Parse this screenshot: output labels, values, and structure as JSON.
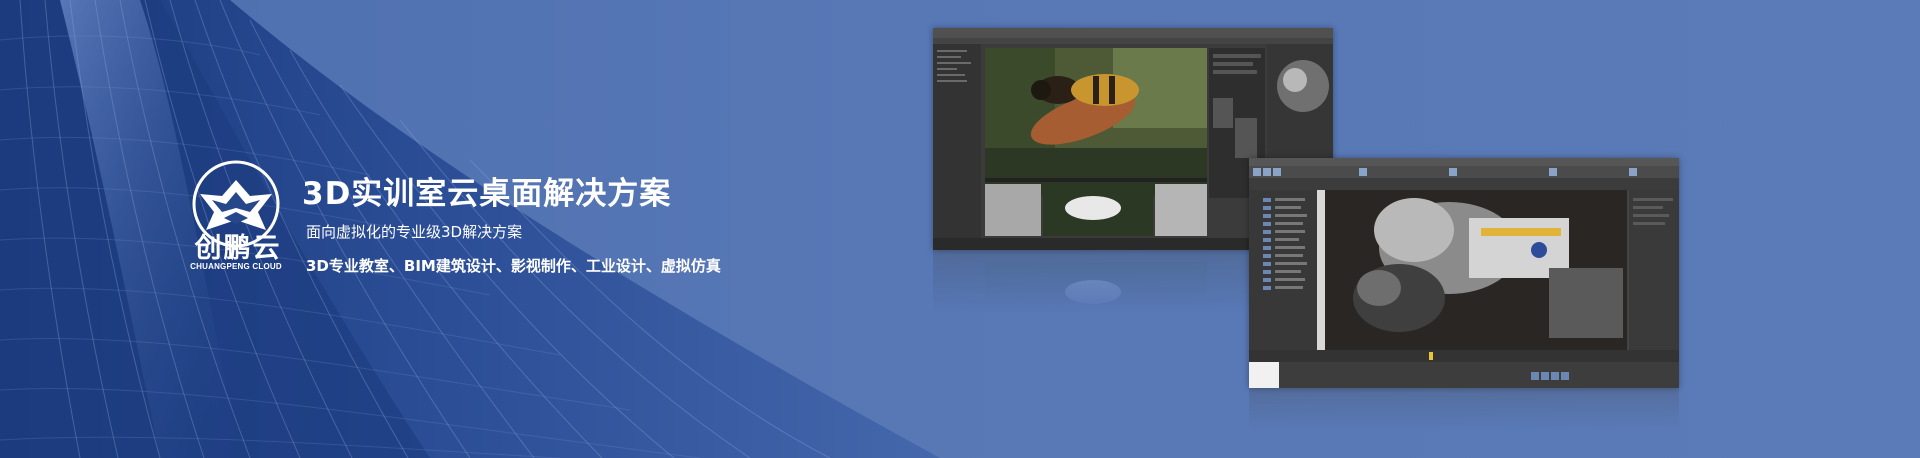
{
  "banner": {
    "title": "3D实训室云桌面解决方案",
    "subtitle": "面向虚拟化的专业级3D解决方案",
    "fields": "3D专业教室、BIM建筑设计、影视制作、工业设计、虚拟仿真"
  },
  "logo": {
    "brand": "创鹏云",
    "sub": "CHUANGPENG CLOUD",
    "icon": "star-in-circle-logo"
  },
  "screenshots": [
    {
      "name": "maya-bee-render",
      "icon": "3d-software-window"
    },
    {
      "name": "3dsmax-spaceship-render",
      "icon": "3d-software-window"
    }
  ],
  "colors": {
    "background": "#5978b6",
    "building": "#1f3f86",
    "text": "#ffffff"
  }
}
